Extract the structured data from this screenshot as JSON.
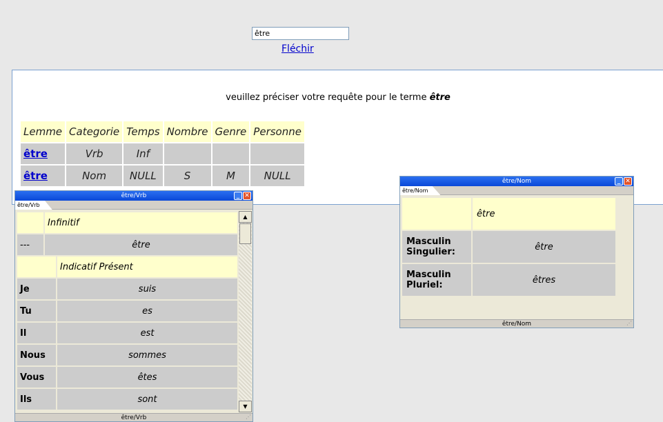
{
  "search": {
    "value": "être",
    "submit_label": "Fléchir"
  },
  "result": {
    "message_prefix": "veuillez préciser votre requête pour le terme ",
    "term": "être",
    "headers": [
      "Lemme",
      "Categorie",
      "Temps",
      "Nombre",
      "Genre",
      "Personne"
    ],
    "rows": [
      {
        "lemme": "être",
        "categorie": "Vrb",
        "temps": "Inf",
        "nombre": "",
        "genre": "",
        "personne": ""
      },
      {
        "lemme": "être",
        "categorie": "Nom",
        "temps": "NULL",
        "nombre": "S",
        "genre": "M",
        "personne": "NULL"
      }
    ]
  },
  "win_vrb": {
    "title": "être/Vrb",
    "tab": "être/Vrb",
    "status": "être/Vrb",
    "sections": [
      {
        "heading": "Infinitif",
        "rows": [
          {
            "k": "---",
            "v": "être"
          }
        ]
      },
      {
        "heading": "Indicatif Présent",
        "rows": [
          {
            "k": "Je",
            "v": "suis"
          },
          {
            "k": "Tu",
            "v": "es"
          },
          {
            "k": "Il",
            "v": "est"
          },
          {
            "k": "Nous",
            "v": "sommes"
          },
          {
            "k": "Vous",
            "v": "êtes"
          },
          {
            "k": "Ils",
            "v": "sont"
          }
        ]
      }
    ]
  },
  "win_nom": {
    "title": "être/Nom",
    "tab": "être/Nom",
    "status": "être/Nom",
    "header_value": "être",
    "rows": [
      {
        "k": "Masculin Singulier:",
        "v": "être"
      },
      {
        "k": "Masculin Pluriel:",
        "v": "êtres"
      }
    ]
  },
  "colors": {
    "header_bg": "#ffffcc",
    "cell_bg": "#cccccc",
    "link": "#0000cc",
    "titlebar": "#0a48d8"
  }
}
